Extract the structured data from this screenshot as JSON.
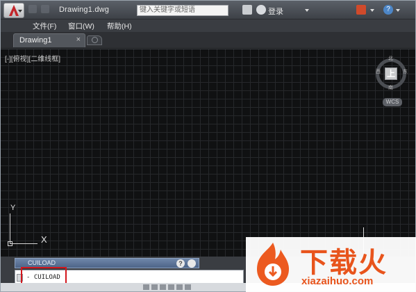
{
  "titlebar": {
    "title": "Drawing1.dwg",
    "search_placeholder": "键入关键字或短语",
    "login_label": "登录",
    "help_label": "?"
  },
  "menubar": {
    "items": [
      {
        "label": "文件(F)"
      },
      {
        "label": "窗口(W)"
      },
      {
        "label": "帮助(H)"
      }
    ]
  },
  "tabs": {
    "active": {
      "label": "Drawing1",
      "close": "×"
    }
  },
  "canvas": {
    "viewport_label": "[-][俯视][二维线框]",
    "viewcube": {
      "face": "上",
      "north": "北",
      "south": "南",
      "west": "西",
      "east": "东",
      "wcs": "WCS"
    },
    "ucs": {
      "y": "Y",
      "x": "X"
    }
  },
  "command": {
    "history_text": "CUILOAD",
    "help_icon": "?",
    "input_value": "- CUILOAD"
  },
  "watermark": {
    "cn": "下载火",
    "en": "xiazaihuo.com"
  },
  "colors": {
    "canvas_bg": "#101112",
    "grid": "#26282b",
    "highlight": "#d3161d",
    "brand": "#e8541c"
  }
}
